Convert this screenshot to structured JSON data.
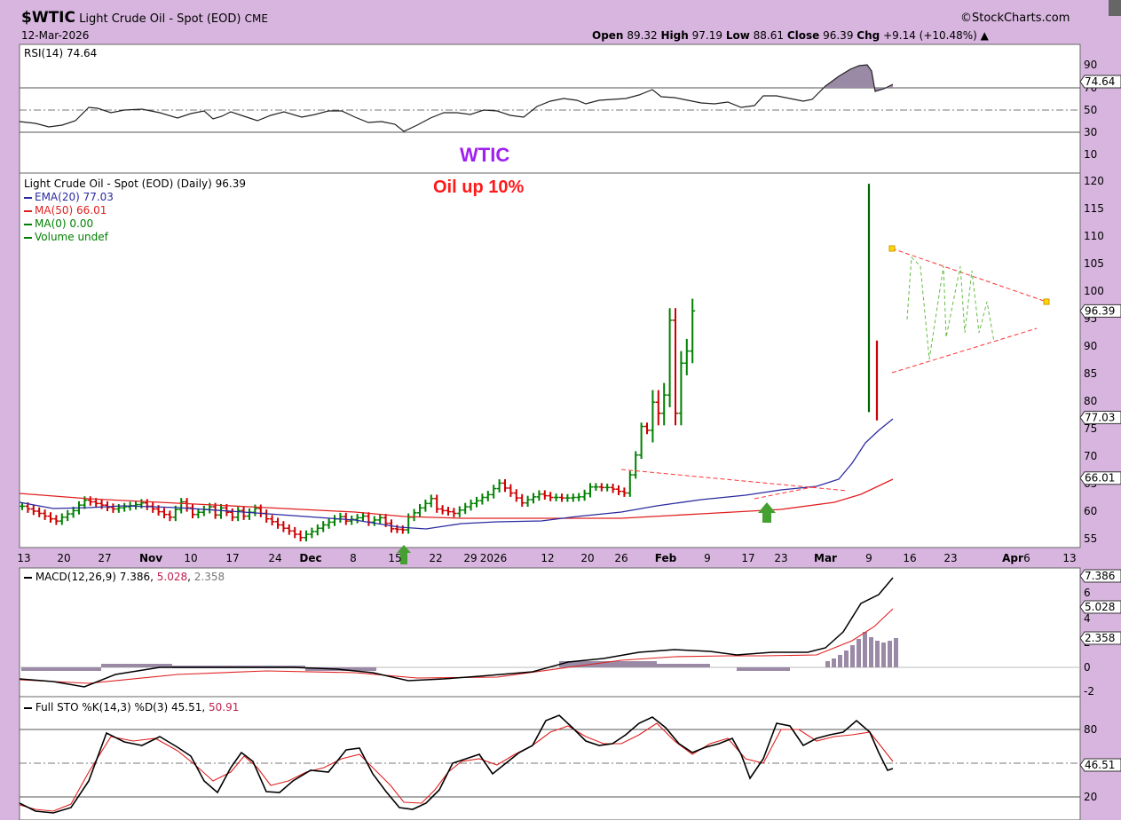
{
  "header": {
    "symbol": "$WTIC",
    "name": "Light Crude Oil - Spot (EOD)",
    "exchange": "CME",
    "date": "12-Mar-2026",
    "brand": "©StockCharts.com",
    "ohlc": {
      "open_label": "Open",
      "open": "89.32",
      "high_label": "High",
      "high": "97.19",
      "low_label": "Low",
      "low": "88.61",
      "close_label": "Close",
      "close": "96.39",
      "chg_label": "Chg",
      "chg": "+9.14 (+10.48%)"
    }
  },
  "annotations": {
    "title": "WTIC",
    "subtitle": "Oil up 10%"
  },
  "colors": {
    "background": "#d7b5de",
    "panel": "#ffffff",
    "up": "#008000",
    "down": "#cc0000",
    "ema": "#2a2aa0",
    "ma50": "#e02020",
    "trend": "#ff3333",
    "arrow": "#44a030",
    "annotation_title": "#a020f0",
    "annotation_sub": "#ff1a1a"
  },
  "rsi_panel": {
    "label": "RSI(14) 74.64",
    "ticks": [
      "90",
      "70",
      "50",
      "30",
      "10"
    ],
    "current": "74.64"
  },
  "price_panel": {
    "legend": [
      {
        "text": "Light Crude Oil - Spot (EOD) (Daily) 96.39",
        "color": "#000000"
      },
      {
        "text": "EMA(20) 77.03",
        "color": "#2a2aa0"
      },
      {
        "text": "MA(50) 66.01",
        "color": "#e02020"
      },
      {
        "text": "MA(0) 0.00",
        "color": "#008000"
      },
      {
        "text": "Volume undef",
        "color": "#008000"
      }
    ],
    "ticks": [
      "120",
      "115",
      "110",
      "105",
      "100",
      "95",
      "90",
      "85",
      "80",
      "75",
      "70",
      "65",
      "60",
      "55"
    ],
    "current_tags": [
      "96.39",
      "77.03",
      "66.01"
    ]
  },
  "x_axis": [
    "13",
    "20",
    "27",
    "Nov",
    "10",
    "17",
    "24",
    "Dec",
    "8",
    "15",
    "22",
    "29",
    "2026",
    "12",
    "20",
    "26",
    "Feb",
    "9",
    "17",
    "23",
    "Mar",
    "9",
    "16",
    "23",
    "Apr",
    "6",
    "13"
  ],
  "macd_panel": {
    "label_prefix": "MACD(12,26,9)",
    "v1": "7.386",
    "v2": "5.028",
    "v3": "2.358",
    "ticks": [
      "6",
      "4",
      "2",
      "0",
      "-2"
    ],
    "tags": [
      "7.386",
      "5.028",
      "2.358"
    ]
  },
  "sto_panel": {
    "label_prefix": "Full STO %K(14,3) %D(3)",
    "k": "45.51",
    "d": "50.91",
    "ticks": [
      "80",
      "20"
    ],
    "tag": "46.51"
  },
  "chart_data": {
    "type": "ohlc",
    "symbol": "$WTIC",
    "ylim": [
      53,
      121
    ],
    "dates_start": "2025-10-13",
    "closes": [
      60.9,
      60.4,
      60.0,
      59.6,
      59.1,
      58.6,
      58.2,
      58.9,
      59.5,
      60.1,
      61.1,
      62.0,
      61.7,
      61.4,
      61.1,
      60.7,
      60.4,
      60.6,
      60.8,
      61.0,
      61.2,
      61.5,
      60.9,
      60.4,
      59.9,
      59.4,
      58.9,
      60.3,
      61.7,
      60.6,
      59.4,
      59.8,
      60.3,
      60.8,
      59.3,
      60.6,
      59.8,
      58.9,
      60.1,
      59.1,
      59.8,
      60.5,
      59.6,
      58.6,
      58.1,
      57.5,
      56.9,
      56.4,
      55.8,
      55.2,
      55.8,
      56.3,
      56.9,
      57.5,
      58.0,
      58.6,
      59.0,
      58.2,
      58.5,
      58.8,
      59.1,
      58.0,
      58.4,
      58.8,
      57.8,
      56.8,
      56.7,
      56.6,
      58.9,
      59.7,
      60.6,
      61.4,
      62.3,
      60.4,
      60.1,
      59.9,
      59.6,
      60.2,
      60.8,
      61.4,
      61.9,
      62.5,
      63.0,
      64.1,
      65.1,
      64.2,
      63.3,
      62.4,
      61.5,
      62.1,
      62.6,
      63.1,
      62.8,
      62.5,
      62.5,
      62.4,
      62.4,
      62.5,
      62.6,
      63.2,
      64.4,
      64.4,
      64.3,
      64.3,
      64.0,
      63.6,
      63.3,
      66.6,
      70.2,
      75.4,
      74.7,
      79.8,
      77.8,
      81.1,
      94.7,
      77.8,
      86.9,
      89.1,
      96.4
    ],
    "up_days_markers": [
      "2025-12-17",
      "2026-02-20"
    ],
    "ema20_last": 77.03,
    "ma50_last": 66.01,
    "trendlines": {
      "triangle_upper": [
        [
          "2026-03-13",
          108.0
        ],
        [
          "2026-04-09",
          98.5
        ]
      ],
      "triangle_lower": [
        [
          "2026-03-13",
          85.0
        ],
        [
          "2026-04-07",
          93.5
        ]
      ],
      "flag_upper": [
        [
          "2026-01-23",
          66.5
        ],
        [
          "2026-03-03",
          62.5
        ]
      ]
    }
  }
}
